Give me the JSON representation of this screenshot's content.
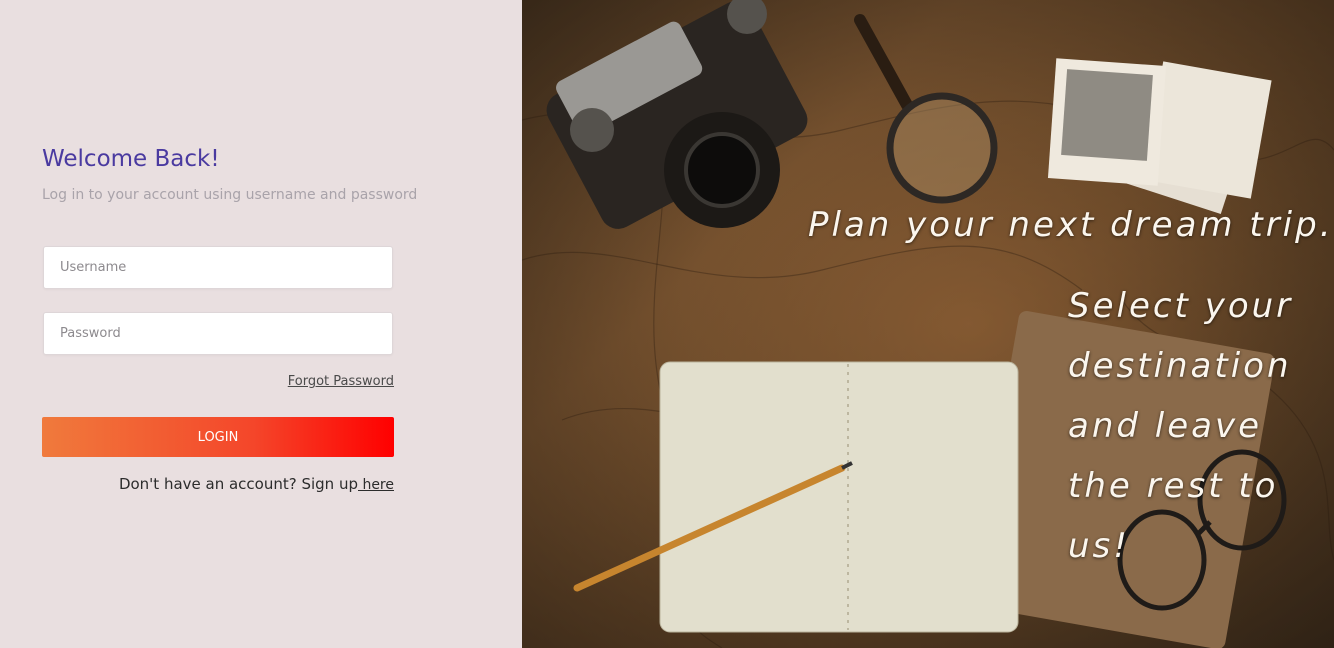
{
  "login": {
    "title": "Welcome Back!",
    "subtitle": "Log in to your account using username and password",
    "username_placeholder": "Username",
    "password_placeholder": "Password",
    "forgot_label": "Forgot Password",
    "login_label": "LOGIN",
    "signup_text": "Don't have an account? Sign up",
    "signup_link": " here"
  },
  "hero": {
    "line1": "Plan your next dream trip.",
    "line2": "Select your destination and leave the rest to us!"
  },
  "colors": {
    "panel_bg": "#e9dfe0",
    "title": "#4a3aa0",
    "button_start": "#f07a3c",
    "button_end": "#ff0000"
  }
}
